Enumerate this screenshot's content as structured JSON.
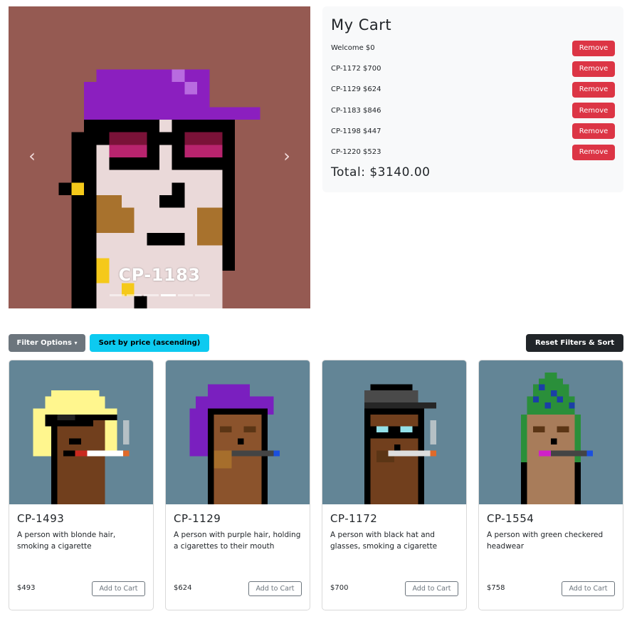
{
  "carousel": {
    "caption": "CP-1183",
    "prev_icon": "chevron-left-icon",
    "next_icon": "chevron-right-icon",
    "indicator_count": 6,
    "active_index": 3,
    "background": "#955a52"
  },
  "cart": {
    "title": "My Cart",
    "items": [
      {
        "label": "Welcome $0",
        "remove": "Remove"
      },
      {
        "label": "CP-1172 $700",
        "remove": "Remove"
      },
      {
        "label": "CP-1129 $624",
        "remove": "Remove"
      },
      {
        "label": "CP-1183 $846",
        "remove": "Remove"
      },
      {
        "label": "CP-1198 $447",
        "remove": "Remove"
      },
      {
        "label": "CP-1220 $523",
        "remove": "Remove"
      }
    ],
    "total": "Total: $3140.00"
  },
  "toolbar": {
    "filter_label": "Filter Options",
    "filter_caret": "▾",
    "sort_label": "Sort by price (ascending)",
    "reset_label": "Reset Filters & Sort"
  },
  "products": [
    {
      "id": "CP-1493",
      "description": "A person with blonde hair, smoking a cigarette",
      "price": "$493",
      "button": "Add to Cart"
    },
    {
      "id": "CP-1129",
      "description": "A person with purple hair, holding a cigarettes to their mouth",
      "price": "$624",
      "button": "Add to Cart"
    },
    {
      "id": "CP-1172",
      "description": "A person with black hat and glasses, smoking a cigarette",
      "price": "$700",
      "button": "Add to Cart"
    },
    {
      "id": "CP-1554",
      "description": "A person with green checkered headwear",
      "price": "$758",
      "button": "Add to Cart"
    }
  ],
  "colors": {
    "remove": "#dc3545",
    "filter": "#6c757d",
    "sort": "#0dcaf0",
    "reset": "#212529",
    "card_bg": "#638596"
  }
}
